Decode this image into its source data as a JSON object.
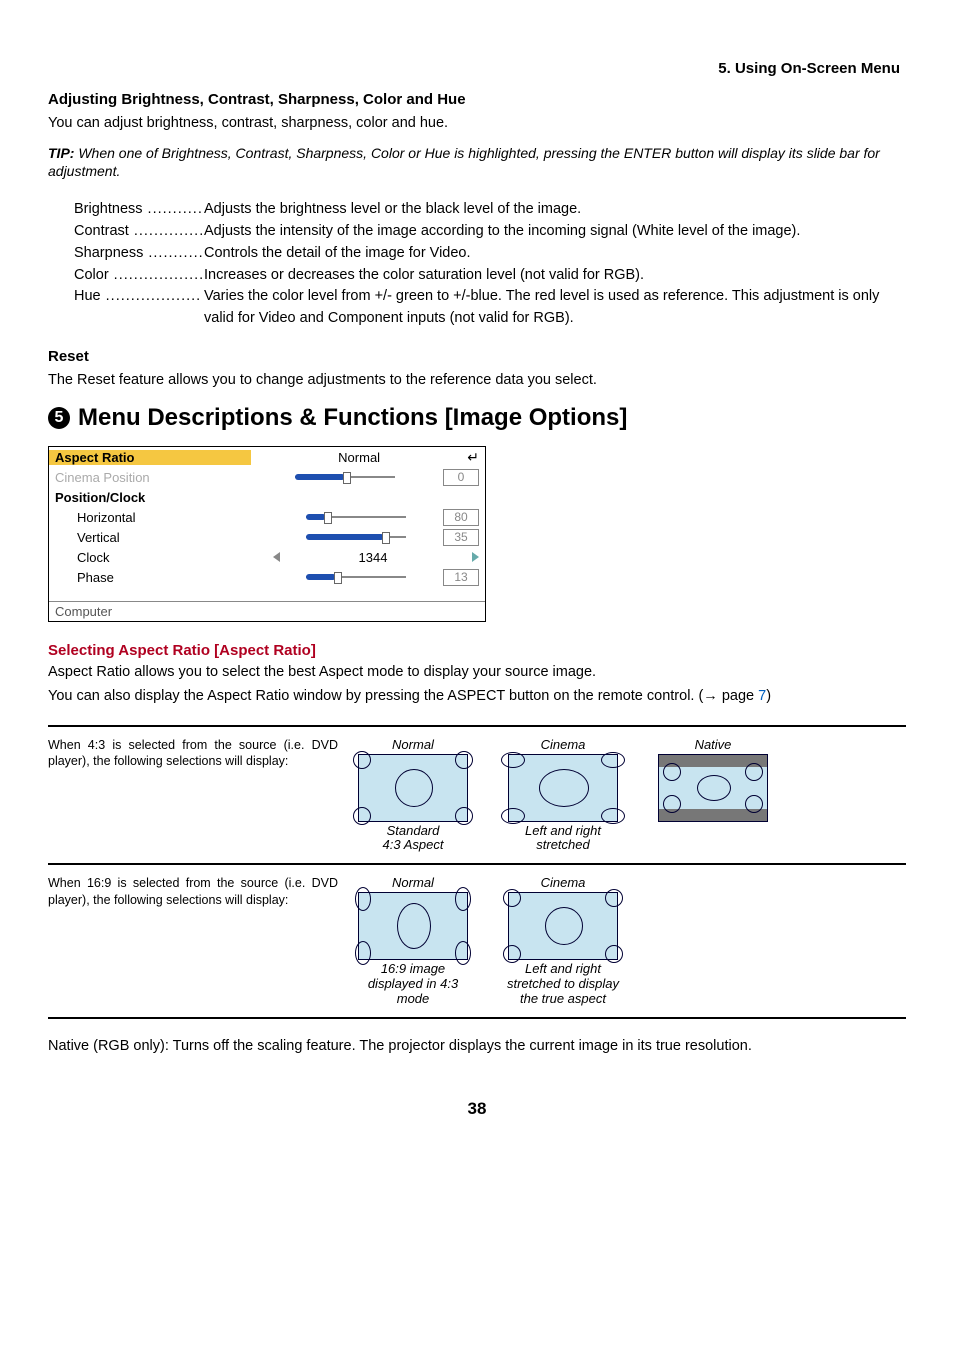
{
  "header": {
    "section": "5. Using On-Screen Menu"
  },
  "adjust": {
    "title": "Adjusting Brightness, Contrast, Sharpness, Color and Hue",
    "intro": "You can adjust brightness, contrast, sharpness, color and hue.",
    "tip_label": "TIP:",
    "tip_body": "When one of Brightness, Contrast, Sharpness, Color or Hue is highlighted, pressing the ENTER button will display its slide bar for adjustment.",
    "items": [
      {
        "term": "Brightness",
        "desc": "Adjusts the brightness level or the black level of the image."
      },
      {
        "term": "Contrast",
        "desc": "Adjusts the intensity of the image according to the incoming signal (White level of the image)."
      },
      {
        "term": "Sharpness",
        "desc": "Controls the detail of the image for Video."
      },
      {
        "term": "Color",
        "desc": "Increases or decreases the color saturation level (not valid for RGB)."
      },
      {
        "term": "Hue",
        "desc": "Varies the color level from +/- green to +/-blue. The red level is used as reference. This adjustment is only valid for Video and Component inputs (not valid for RGB)."
      }
    ]
  },
  "reset": {
    "title": "Reset",
    "body": "The Reset feature allows you to change adjustments to the reference data you select."
  },
  "main": {
    "num": "5",
    "title": "Menu Descriptions & Functions [Image Options]"
  },
  "osd": {
    "aspect_label": "Aspect Ratio",
    "aspect_value": "Normal",
    "cinema_label": "Cinema Position",
    "cinema_value": "0",
    "group_label": "Position/Clock",
    "horiz_label": "Horizontal",
    "horiz_value": "80",
    "vert_label": "Vertical",
    "vert_value": "35",
    "clock_label": "Clock",
    "clock_value": "1344",
    "phase_label": "Phase",
    "phase_value": "13",
    "footer": "Computer"
  },
  "aspect": {
    "heading": "Selecting Aspect Ratio [Aspect Ratio]",
    "line1": "Aspect Ratio allows you to select the best Aspect mode to display your source image.",
    "line2_a": "You can also display the Aspect Ratio window by pressing the ASPECT button on the remote control. (",
    "line2_arrow": "→",
    "line2_page_word": "page ",
    "line2_page_num": "7",
    "line2_b": ")",
    "row43_text": "When 4:3 is selected from the source (i.e. DVD player), the following selections will display:",
    "row169_text": "When 16:9 is selected from the source (i.e. DVD player), the following selections will display:",
    "labels": {
      "normal": "Normal",
      "cinema": "Cinema",
      "native": "Native",
      "std_caption": "Standard\n4:3 Aspect",
      "lr_stretched": "Left and right\nstretched",
      "caption_169_normal": "16:9 image\ndisplayed in 4:3\nmode",
      "caption_169_cinema": "Left and right\nstretched to display\nthe true aspect"
    },
    "native_note": "Native (RGB only): Turns off the scaling feature. The projector displays the current image in its true resolution."
  },
  "page_number": "38"
}
